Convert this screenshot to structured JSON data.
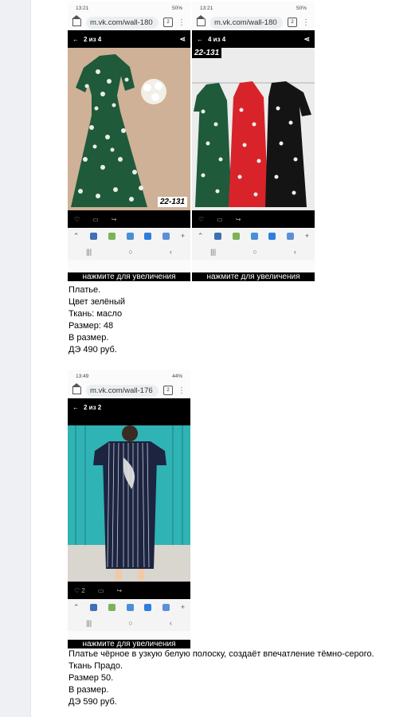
{
  "post1": {
    "screens": [
      {
        "status_time": "13:21",
        "status_right": "50%",
        "url": "m.vk.com/wall-180",
        "counter": "2 из 4",
        "tag": "22-131",
        "zoom_label": "нажмите для увеличения"
      },
      {
        "status_time": "13:21",
        "status_right": "50%",
        "url": "m.vk.com/wall-180",
        "counter": "4 из 4",
        "tag": "22-131",
        "zoom_label": "нажмите для увеличения"
      }
    ],
    "lines": [
      "Платье.",
      "Цвет зелёный",
      "Ткань: масло",
      "Размер: 48",
      "В размер.",
      "ДЭ 490 руб."
    ]
  },
  "post2": {
    "screen": {
      "status_time": "13:49",
      "status_right": "44%",
      "url": "m.vk.com/wall-176",
      "counter": "2 из 2",
      "likes": "2",
      "zoom_label": "нажмите для увеличения"
    },
    "lines": [
      "Платье чёрное в узкую белую полоску, создаёт впечатление тёмно-серого.",
      "Ткань Прадо.",
      "Размер 50.",
      "В размер.",
      "ДЭ 590 руб."
    ]
  },
  "icons": {
    "back": "back-arrow-icon",
    "share": "share-icon",
    "like": "heart-icon",
    "comment": "comment-icon",
    "repost": "repost-icon",
    "home": "home-icon",
    "tabs": "tabs-icon",
    "menu": "more-vert-icon"
  },
  "colors": {
    "green_dress": "#1f5a3a",
    "red_dress": "#d8232a",
    "black_dress": "#141414",
    "turquoise_wall": "#2fb3b4",
    "striped_dress": "#1c2440"
  }
}
